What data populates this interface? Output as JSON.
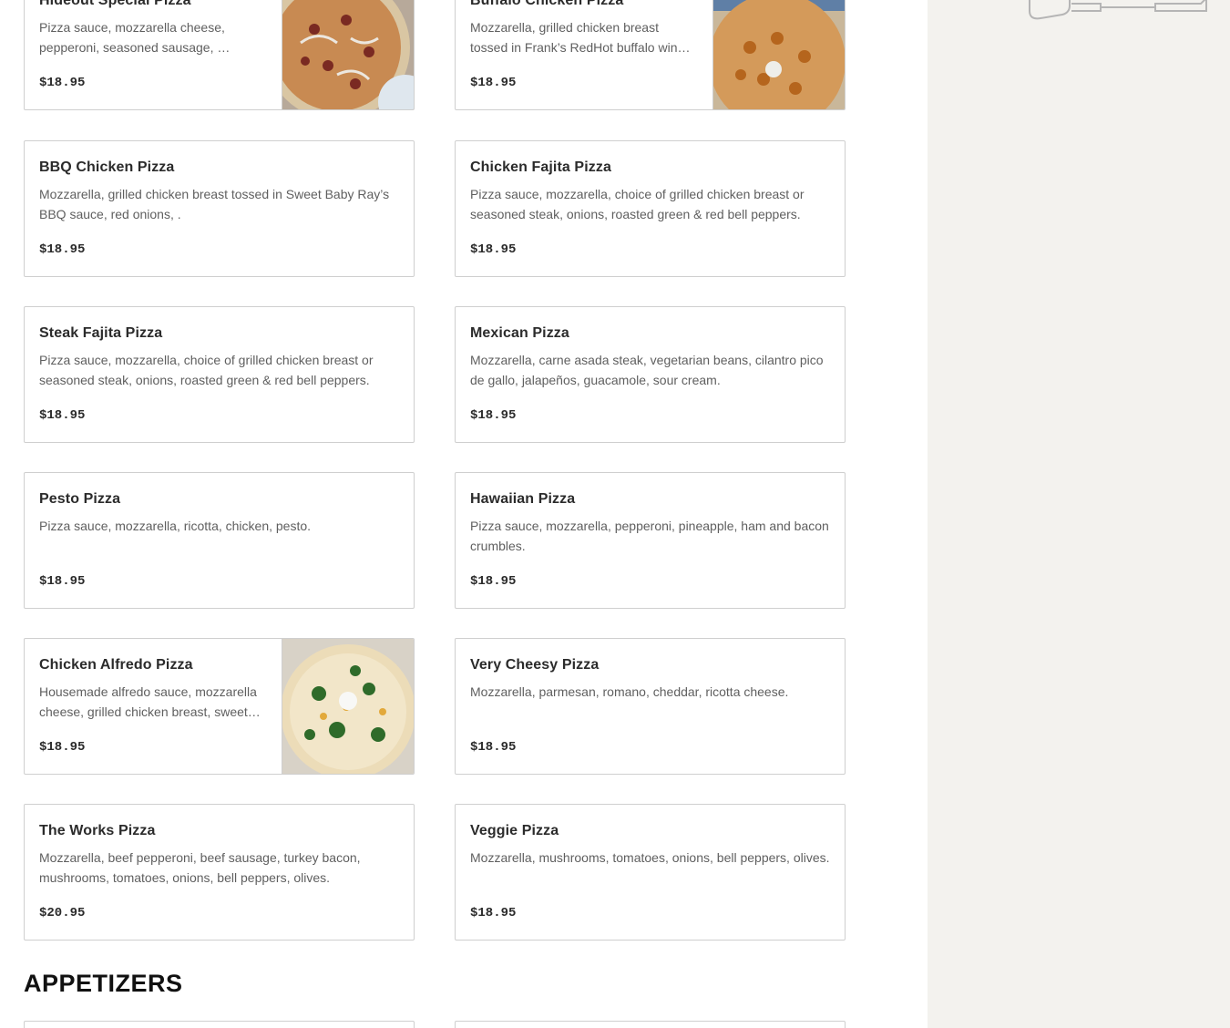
{
  "menu": {
    "items": [
      {
        "name": "Hideout Special Pizza",
        "desc": "Pizza sauce, mozzarella cheese, pepperoni, seasoned sausage, …",
        "price": "$18.95"
      },
      {
        "name": "Buffalo Chicken Pizza",
        "desc": "Mozzarella, grilled chicken breast tossed in Frank’s RedHot buffalo win…",
        "price": "$18.95"
      },
      {
        "name": "BBQ Chicken Pizza",
        "desc": "Mozzarella, grilled chicken breast tossed in Sweet Baby Ray’s BBQ sauce, red onions, .",
        "price": "$18.95"
      },
      {
        "name": "Chicken Fajita Pizza",
        "desc": "Pizza sauce, mozzarella, choice of grilled chicken breast or seasoned steak, onions, roasted green & red bell peppers.",
        "price": "$18.95"
      },
      {
        "name": "Steak Fajita Pizza",
        "desc": "Pizza sauce, mozzarella, choice of grilled chicken breast or seasoned steak, onions, roasted green & red bell peppers.",
        "price": "$18.95"
      },
      {
        "name": "Mexican Pizza",
        "desc": "Mozzarella, carne asada steak, vegetarian beans, cilantro pico de gallo, jalapeños, guacamole, sour cream.",
        "price": "$18.95"
      },
      {
        "name": "Pesto Pizza",
        "desc": "Pizza sauce, mozzarella, ricotta, chicken, pesto.",
        "price": "$18.95"
      },
      {
        "name": "Hawaiian Pizza",
        "desc": "Pizza sauce, mozzarella, pepperoni, pineapple, ham and bacon crumbles.",
        "price": "$18.95"
      },
      {
        "name": "Chicken Alfredo Pizza",
        "desc": "Housemade alfredo sauce, mozzarella cheese, grilled chicken breast, sweet…",
        "price": "$18.95"
      },
      {
        "name": "Very Cheesy Pizza",
        "desc": "Mozzarella, parmesan, romano, cheddar, ricotta cheese.",
        "price": "$18.95"
      },
      {
        "name": "The Works Pizza",
        "desc": "Mozzarella, beef pepperoni, beef sausage, turkey bacon, mushrooms, tomatoes, onions, bell peppers, olives.",
        "price": "$20.95"
      },
      {
        "name": "Veggie Pizza",
        "desc": "Mozzarella, mushrooms, tomatoes, onions, bell peppers, olives.",
        "price": "$18.95"
      }
    ]
  },
  "section": {
    "appetizers": "APPETIZERS"
  },
  "colors": {
    "border": "#cfcfcf",
    "sidebar_bg": "#f3f2ee",
    "text": "#2b2b2b",
    "muted": "#5f5f5f"
  }
}
